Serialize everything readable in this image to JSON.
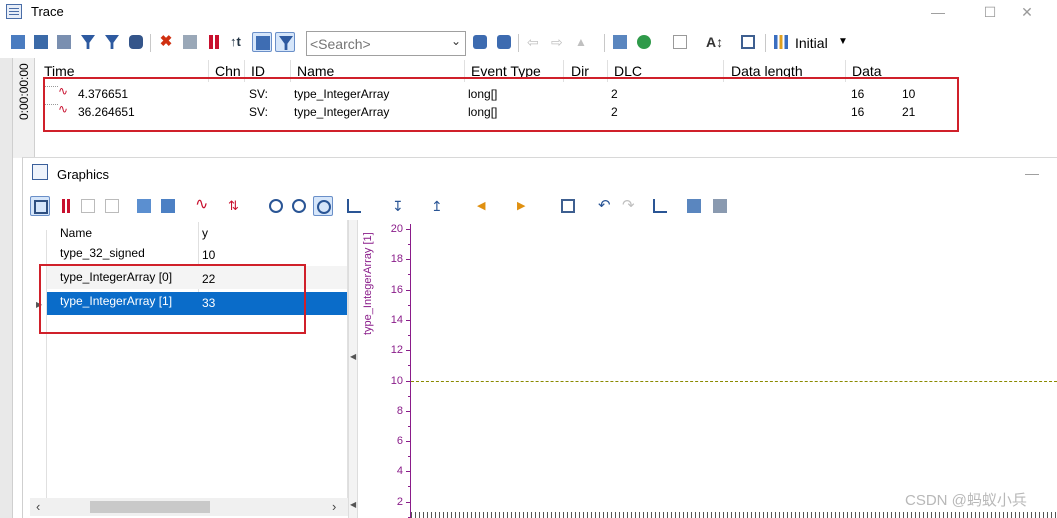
{
  "trace": {
    "title": "Trace",
    "search": {
      "placeholder": "<Search>"
    },
    "filter_label": "Initial",
    "time_strip": "0:00:00:00",
    "columns": [
      "Time",
      "Chn",
      "ID",
      "Name",
      "Event Type",
      "Dir",
      "DLC",
      "Data length",
      "Data"
    ],
    "rows": [
      {
        "time": "4.376651",
        "id": "SV:",
        "name": "type_IntegerArray",
        "event_type": "long[]",
        "dlc": "2",
        "data_length": "16",
        "data": "10"
      },
      {
        "time": "36.264651",
        "id": "SV:",
        "name": "type_IntegerArray",
        "event_type": "long[]",
        "dlc": "2",
        "data_length": "16",
        "data": "21"
      }
    ]
  },
  "graphics": {
    "title": "Graphics",
    "columns": {
      "name": "Name",
      "y": "y"
    },
    "signals": [
      {
        "name": "type_32_signed",
        "y": "10"
      },
      {
        "name": "type_IntegerArray [0]",
        "y": "22"
      },
      {
        "name": "type_IntegerArray [1]",
        "y": "33"
      }
    ],
    "y_axis": {
      "title": "type_IntegerArray [1]",
      "ticks": [
        "20",
        "18",
        "16",
        "14",
        "12",
        "10",
        "8",
        "6",
        "4",
        "2"
      ],
      "value_line": 10
    }
  },
  "watermark": "CSDN @蚂蚁小兵",
  "colors": {
    "accent": "#0a6cc9",
    "highlight": "#d0202a",
    "axis": "#8a1d8a"
  }
}
